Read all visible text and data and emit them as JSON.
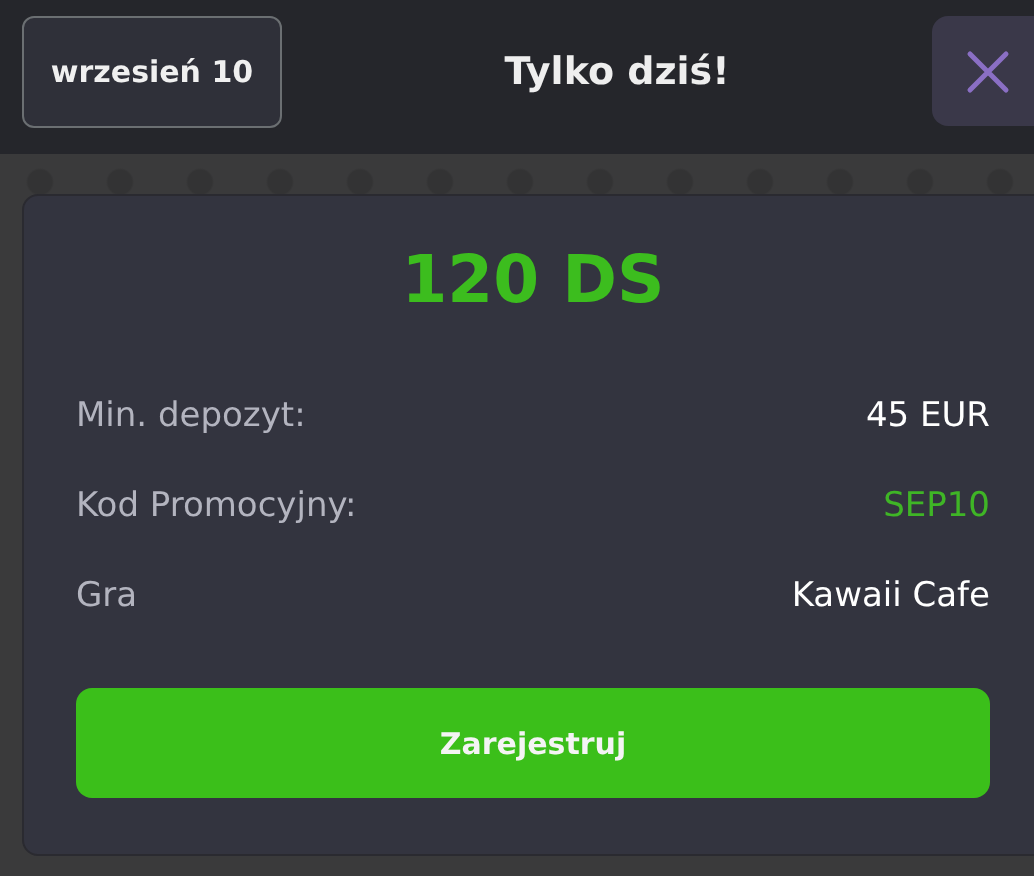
{
  "header": {
    "date": "wrzesień 10",
    "title": "Tylko dziś!"
  },
  "offer": {
    "amount": "120 DS",
    "rows": [
      {
        "label": "Min. depozyt:",
        "value": "45 EUR",
        "kind": "plain"
      },
      {
        "label": "Kod Promocyjny:",
        "value": "SEP10",
        "kind": "code"
      },
      {
        "label": "Gra",
        "value": "Kawaii Cafe",
        "kind": "plain"
      }
    ],
    "button": "Zarejestruj"
  }
}
